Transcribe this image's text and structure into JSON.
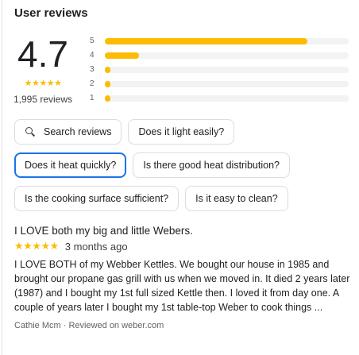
{
  "header": {
    "title": "User reviews"
  },
  "summary": {
    "rating": "4.7",
    "stars_filled": 4.5,
    "review_count_label": "1,995 reviews",
    "bars": [
      {
        "label": "5",
        "fraction": 0.83
      },
      {
        "label": "4",
        "fraction": 0.14
      },
      {
        "label": "3",
        "fraction": 0.02
      },
      {
        "label": "2",
        "fraction": 0.01
      },
      {
        "label": "1",
        "fraction": 0.01
      }
    ],
    "bar_color": "#fbbc04"
  },
  "chips": {
    "search_label": "Search reviews",
    "items": [
      "Does it light easily?",
      "Does it heat quickly?",
      "Is there good heat distribution?",
      "Is the cooking surface sufficient?",
      "Is it easy to clean?"
    ],
    "selected_color": "#1a73e8"
  },
  "review": {
    "title": "I LOVE both my big and little Webers.",
    "stars": "★★★★★",
    "time": "3 months ago",
    "body": "I LOVE BOTH of my Webber Kettles. We bought our house in 1985 and brought our propane gas grill with us when we moved in. It died 2 years later (1987) and I bought my 1st full sized Kettle then. I loved it from day one. A couple of years later I bought my 1st table-top Weber to cook things ...",
    "source": "Cathie Mcm · Reviewed on weber.com"
  }
}
